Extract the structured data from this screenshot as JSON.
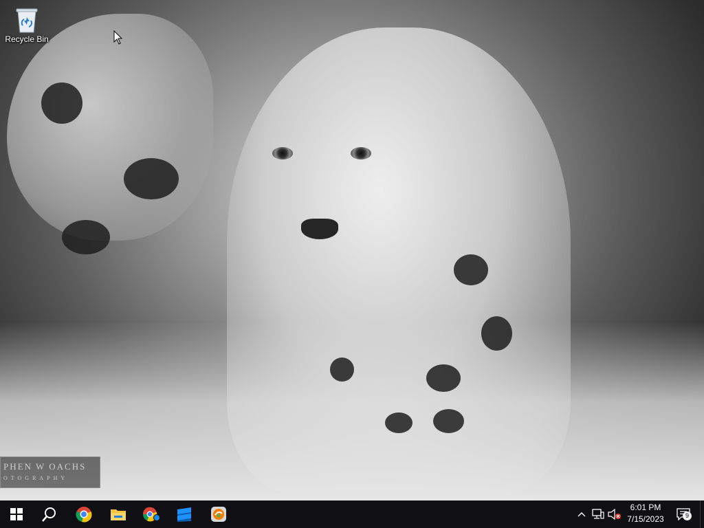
{
  "desktop": {
    "icons": [
      {
        "label": "Recycle Bin",
        "icon": "recycle-bin-icon"
      }
    ],
    "wallpaper_watermark": {
      "line1": "PHEN W OACHS",
      "line2": "OTOGRAPHY"
    }
  },
  "taskbar": {
    "start": {
      "icon": "windows-start-icon"
    },
    "search": {
      "icon": "search-icon"
    },
    "pinned": [
      {
        "name": "Google Chrome",
        "icon": "chrome-icon"
      },
      {
        "name": "File Explorer",
        "icon": "file-explorer-icon"
      },
      {
        "name": "Chrome app",
        "icon": "chrome-app-icon"
      },
      {
        "name": "App",
        "icon": "app-window-icon"
      },
      {
        "name": "App",
        "icon": "app-orange-icon"
      }
    ],
    "tray": {
      "chevron_icon": "chevron-up-icon",
      "network_icon": "network-icon",
      "volume_icon": "volume-muted-icon",
      "clock": {
        "time": "6:01 PM",
        "date": "7/15/2023"
      },
      "notifications": {
        "icon": "notification-icon",
        "count": "9"
      }
    }
  },
  "colors": {
    "taskbar_bg": "#101014",
    "accent_blue": "#1e90ff",
    "muted_red": "#e53935"
  }
}
